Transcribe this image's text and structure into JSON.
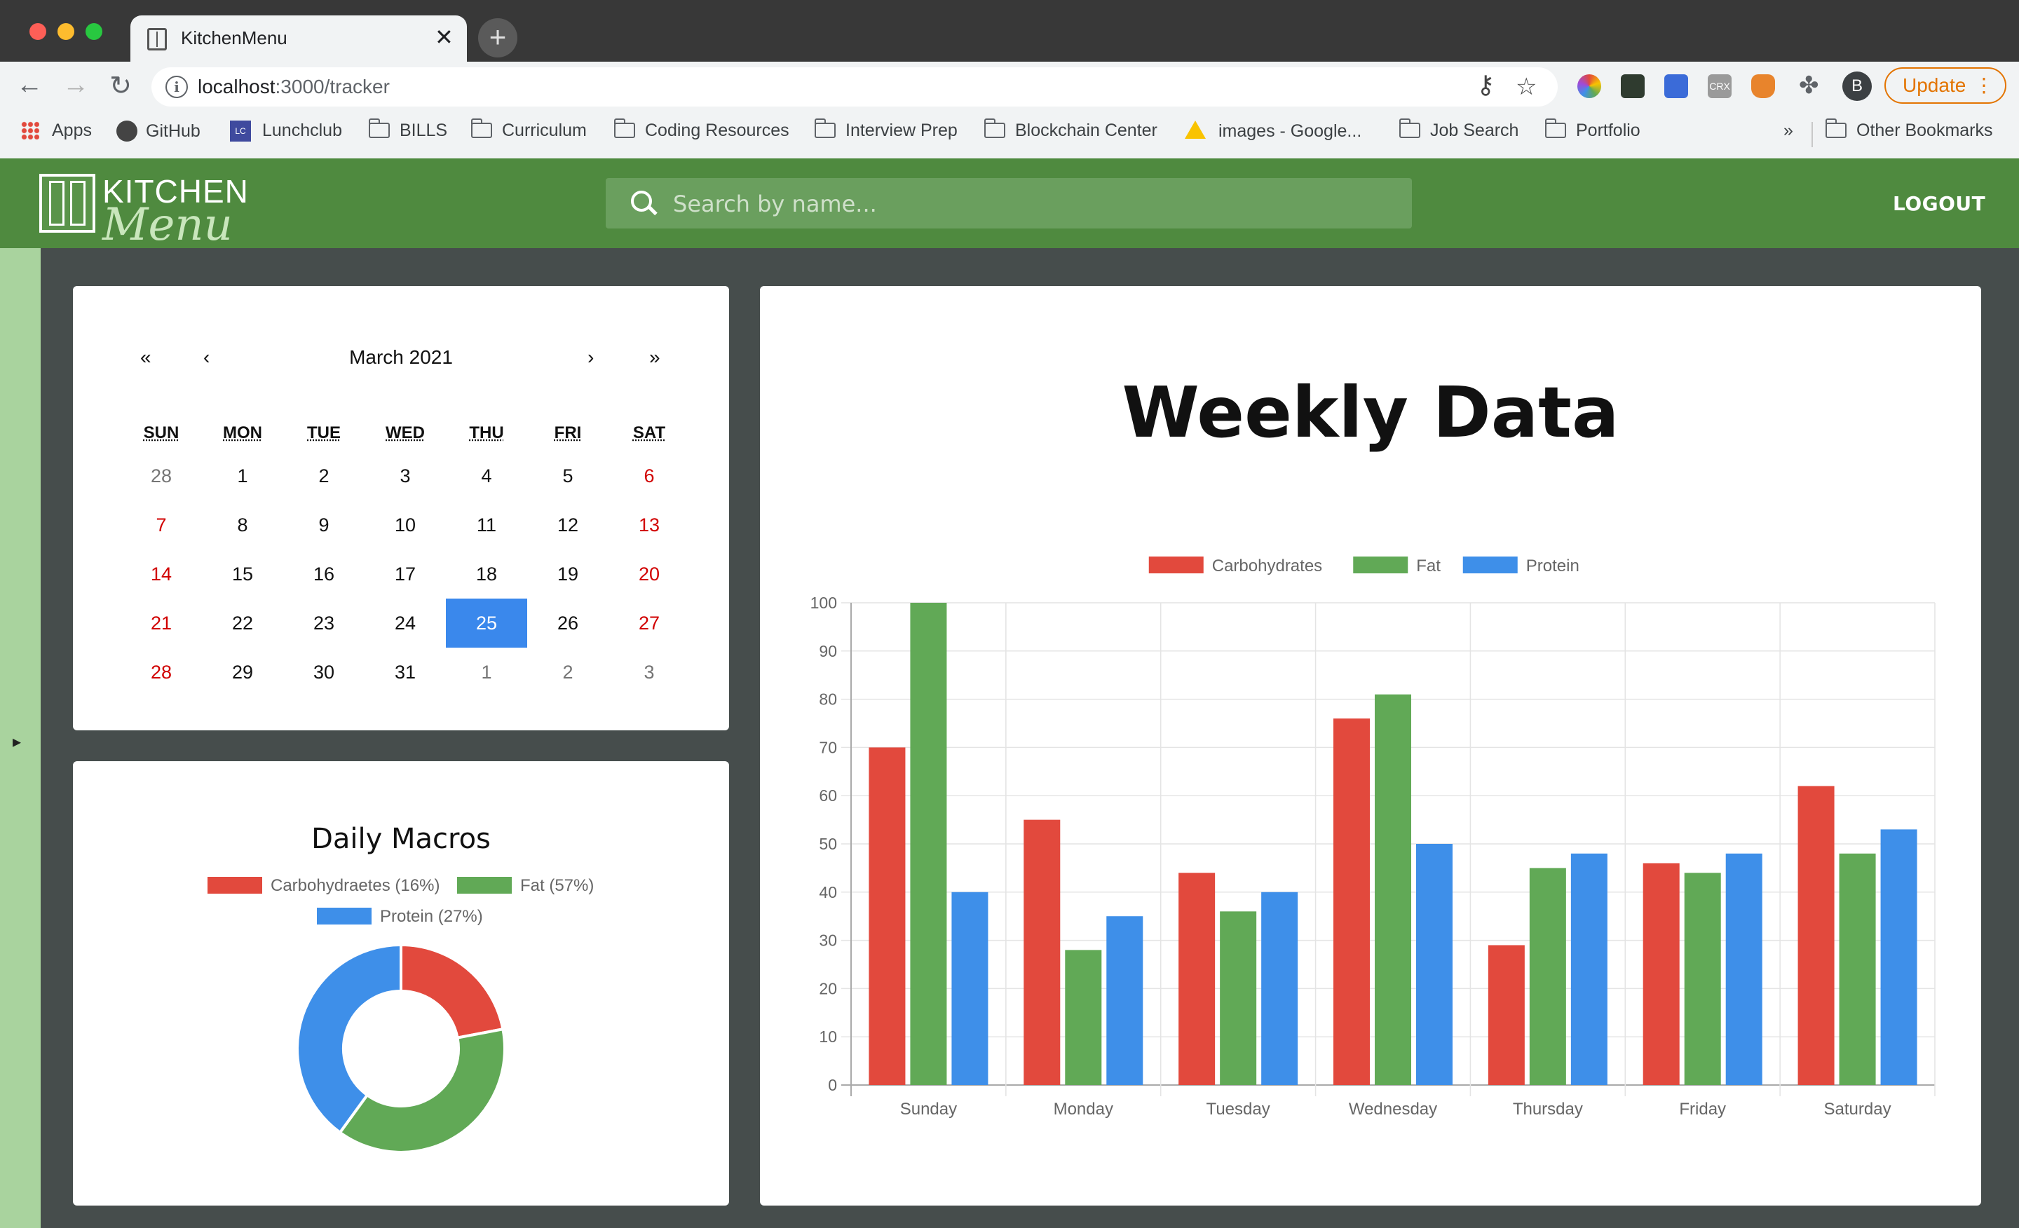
{
  "browser": {
    "tab_title": "KitchenMenu",
    "tab_close": "✕",
    "new_tab": "+",
    "url_host": "localhost",
    "url_rest": ":3000/tracker",
    "update_label": "Update",
    "update_more": "⋮",
    "profile_initial": "B",
    "bookmarks": [
      "Apps",
      "GitHub",
      "Lunchclub",
      "BILLS",
      "Curriculum",
      "Coding Resources",
      "Interview Prep",
      "Blockchain Center",
      "images - Google...",
      "Job Search",
      "Portfolio"
    ],
    "bookmarks_overflow": "»",
    "other_bookmarks": "Other Bookmarks",
    "lunchclub_badge": "LC",
    "crx_badge": "CRX"
  },
  "app": {
    "logo_top": "KITCHEN",
    "logo_bottom": "Menu",
    "search_placeholder": "Search by name...",
    "logout": "LOGOUT",
    "sidebar_toggle": "▸"
  },
  "calendar": {
    "prev_year": "«",
    "prev_month": "‹",
    "next_month": "›",
    "next_year": "»",
    "month_label": "March 2021",
    "weekdays": [
      "SUN",
      "MON",
      "TUE",
      "WED",
      "THU",
      "FRI",
      "SAT"
    ],
    "weeks": [
      [
        "28",
        "1",
        "2",
        "3",
        "4",
        "5",
        "6"
      ],
      [
        "7",
        "8",
        "9",
        "10",
        "11",
        "12",
        "13"
      ],
      [
        "14",
        "15",
        "16",
        "17",
        "18",
        "19",
        "20"
      ],
      [
        "21",
        "22",
        "23",
        "24",
        "25",
        "26",
        "27"
      ],
      [
        "28",
        "29",
        "30",
        "31",
        "1",
        "2",
        "3"
      ]
    ],
    "selected": "25",
    "colors": {
      "weekend": "#d10000",
      "muted": "#757575",
      "selected": "#3a88ec"
    }
  },
  "macros": {
    "title": "Daily Macros",
    "legend": [
      "Carbohydraetes (16%)",
      "Fat (57%)",
      "Protein (27%)"
    ]
  },
  "weekly": {
    "title": "Weekly Data"
  },
  "chart_data": [
    {
      "type": "pie",
      "title": "Daily Macros",
      "donut": true,
      "labels": [
        "Carbohydraetes (16%)",
        "Fat (57%)",
        "Protein (27%)"
      ],
      "values": [
        22,
        38,
        40
      ],
      "colors": [
        "#e2493d",
        "#61a956",
        "#3e8fe9"
      ]
    },
    {
      "type": "bar",
      "title": "Weekly Data",
      "categories": [
        "Sunday",
        "Monday",
        "Tuesday",
        "Wednesday",
        "Thursday",
        "Friday",
        "Saturday"
      ],
      "series": [
        {
          "name": "Carbohydrates",
          "color": "#e2493d",
          "values": [
            70,
            55,
            44,
            76,
            29,
            46,
            62
          ]
        },
        {
          "name": "Fat",
          "color": "#61a956",
          "values": [
            100,
            28,
            36,
            81,
            45,
            44,
            48
          ]
        },
        {
          "name": "Protein",
          "color": "#3e8fe9",
          "values": [
            40,
            35,
            40,
            50,
            48,
            48,
            53
          ]
        }
      ],
      "ylim": [
        0,
        100
      ],
      "yticks": [
        0,
        10,
        20,
        30,
        40,
        50,
        60,
        70,
        80,
        90,
        100
      ],
      "grid": true,
      "legend": "top-center"
    }
  ]
}
